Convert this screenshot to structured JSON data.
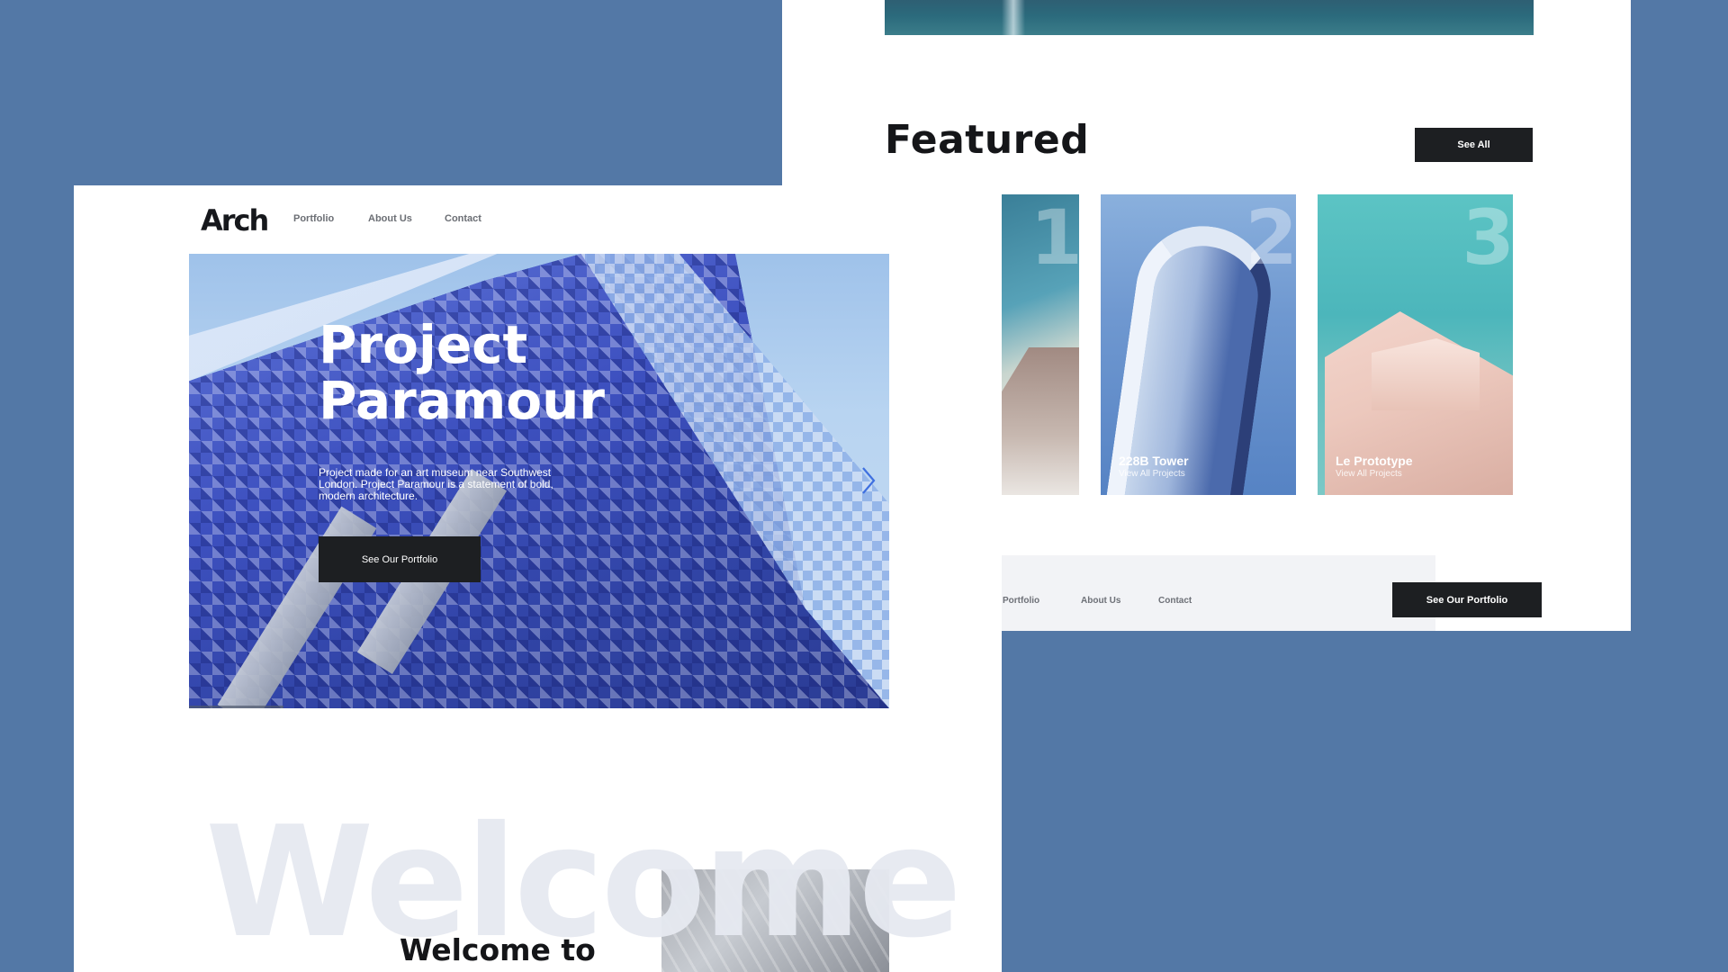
{
  "featured_page": {
    "title": "Featured",
    "see_all_label": "See All",
    "cards": [
      {
        "number": "1",
        "title": "",
        "subtitle": ""
      },
      {
        "number": "2",
        "title": "228B Tower",
        "subtitle": "View All Projects"
      },
      {
        "number": "3",
        "title": "Le Prototype",
        "subtitle": "View All Projects"
      }
    ],
    "footer": {
      "nav": [
        "Portfolio",
        "About Us",
        "Contact"
      ],
      "cta_label": "See Our Portfolio"
    }
  },
  "home_page": {
    "logo": "Arch",
    "nav": [
      "Portfolio",
      "About Us",
      "Contact"
    ],
    "hero": {
      "title": "Project\nParamour",
      "description": "Project made for an art museum near Southwest London. Project Paramour is a statement of bold, modern architecture.",
      "cta_label": "See Our Portfolio",
      "next_icon": "chevron-right-icon"
    },
    "welcome": {
      "background_word": "Welcome",
      "heading": "Welcome to"
    }
  },
  "colors": {
    "background": "#5378a6",
    "button_dark": "#1d1f22",
    "nav_text": "#6b6e74"
  }
}
